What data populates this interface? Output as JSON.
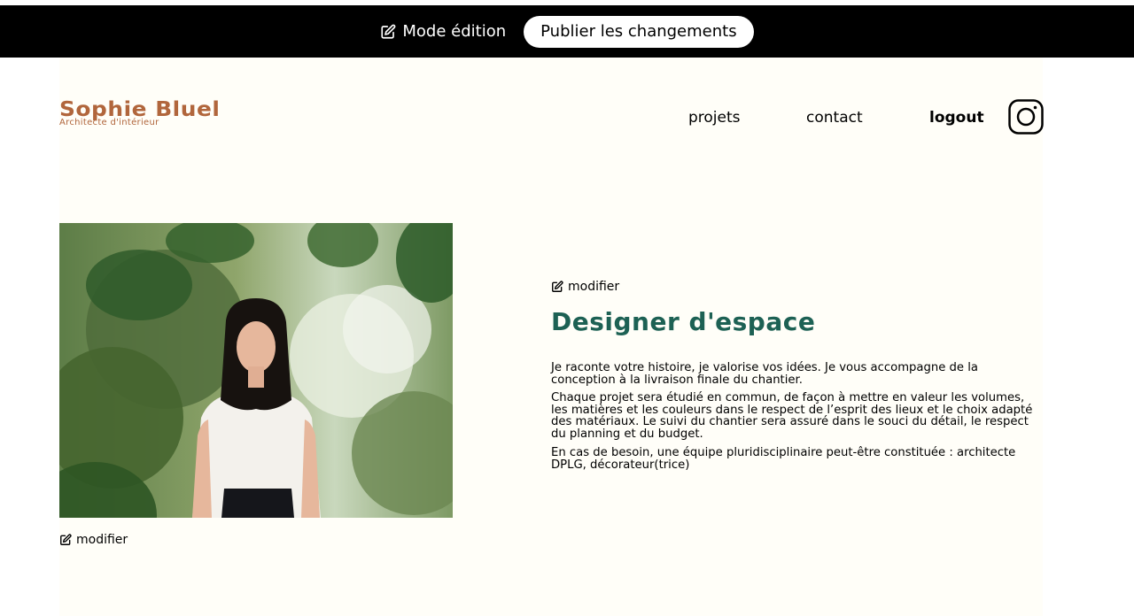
{
  "edit_bar": {
    "mode_label": "Mode édition",
    "publish_label": "Publier les changements"
  },
  "header": {
    "logo_title": "Sophie Bluel",
    "logo_subtitle": "Architecte d'intérieur",
    "nav": {
      "projets": "projets",
      "contact": "contact",
      "logout": "logout"
    },
    "instagram_icon": "instagram-icon"
  },
  "introduction": {
    "photo_modify_label": "modifier",
    "text_modify_label": "modifier",
    "title": "Designer d'espace",
    "paragraphs": [
      "Je raconte votre histoire, je valorise vos idées. Je vous accompagne de la conception à la livraison finale du chantier.",
      "Chaque projet sera étudié en commun, de façon à mettre en valeur les volumes, les matières et les couleurs dans le respect de l’esprit des lieux et le choix adapté des matériaux. Le suivi du chantier sera assuré dans le souci du détail, le respect du planning et du budget.",
      "En cas de besoin, une équipe pluridisciplinaire peut-être constituée : architecte DPLG, décorateur(trice)"
    ]
  },
  "colors": {
    "brand": "#B1663C",
    "title_green": "#1D6154",
    "edit_bar": "#000000",
    "page_bg": "#FFFEF8"
  }
}
